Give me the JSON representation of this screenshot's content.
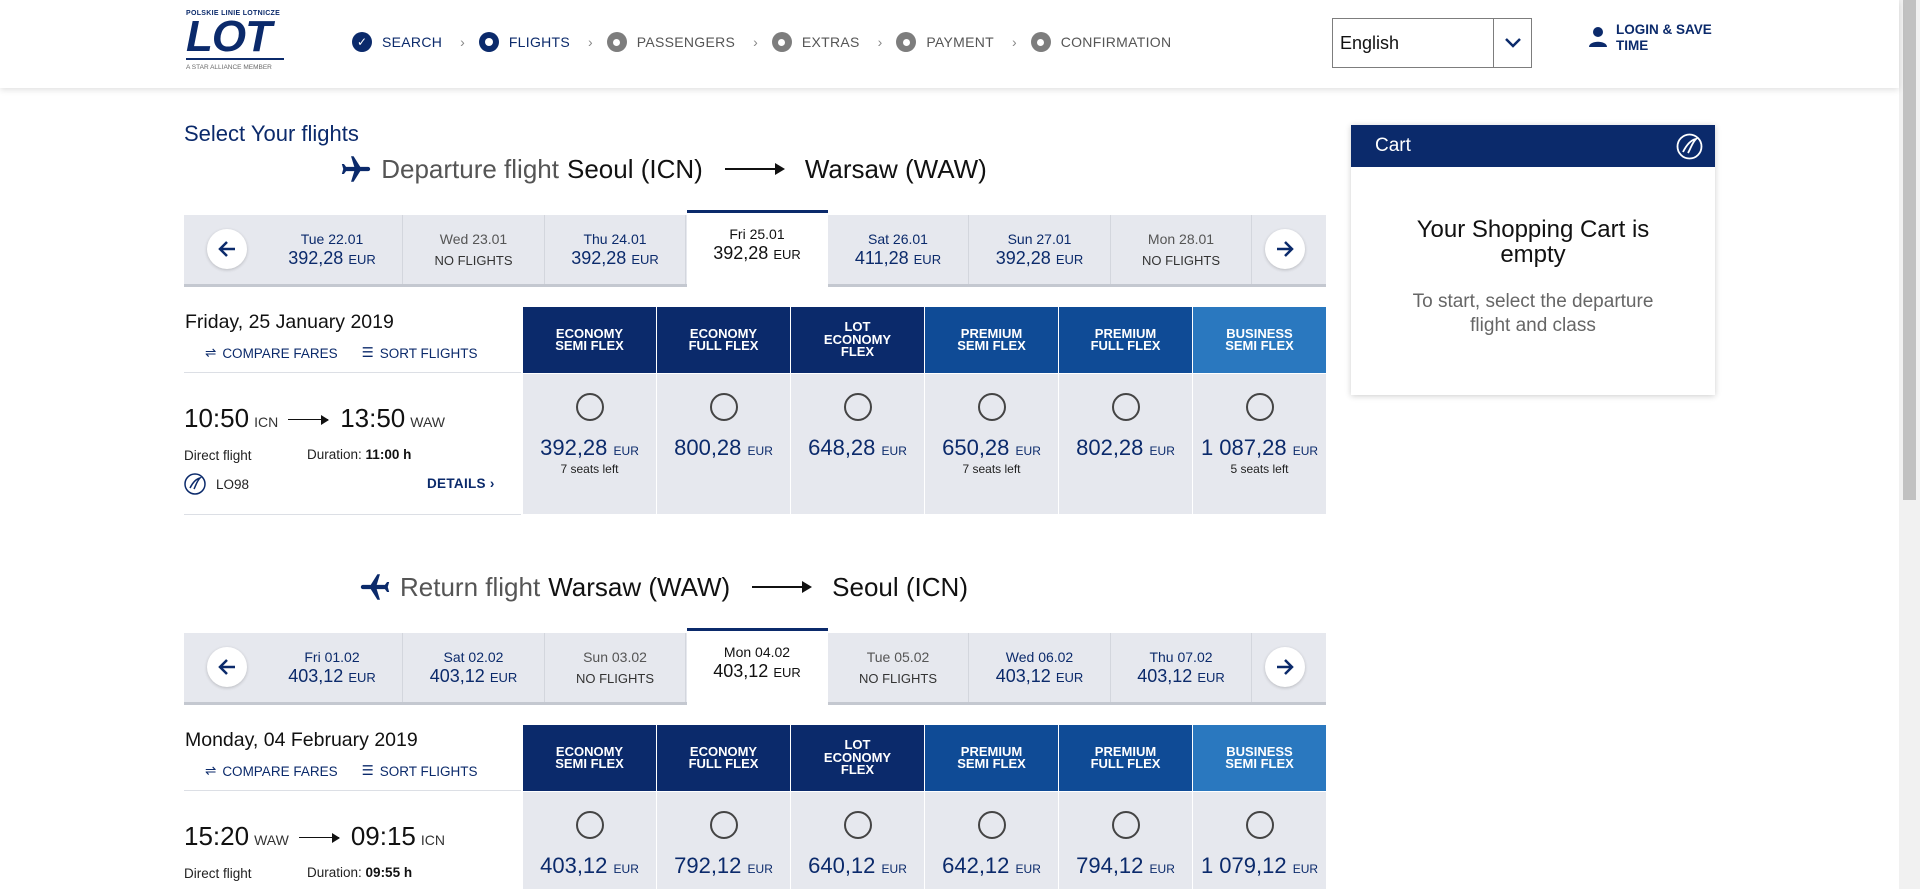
{
  "header": {
    "logo": {
      "top": "POLSKIE LINIE LOTNICZE",
      "main": "LOT",
      "alliance": "A STAR ALLIANCE MEMBER"
    },
    "steps": [
      {
        "label": "SEARCH",
        "state": "done"
      },
      {
        "label": "FLIGHTS",
        "state": "active"
      },
      {
        "label": "PASSENGERS",
        "state": "todo"
      },
      {
        "label": "EXTRAS",
        "state": "todo"
      },
      {
        "label": "PAYMENT",
        "state": "todo"
      },
      {
        "label": "CONFIRMATION",
        "state": "todo"
      }
    ],
    "language": "English",
    "login": {
      "line1": "LOGIN & SAVE",
      "line2": "TIME"
    }
  },
  "page_title": "Select Your flights",
  "departure": {
    "kind": "Departure flight",
    "from": "Seoul (ICN)",
    "to": "Warsaw (WAW)",
    "dates": [
      {
        "day": "Tue 22.01",
        "price": "392,28",
        "cur": "EUR"
      },
      {
        "day": "Wed 23.01",
        "nf": "NO FLIGHTS"
      },
      {
        "day": "Thu 24.01",
        "price": "392,28",
        "cur": "EUR"
      },
      {
        "day": "Fri 25.01",
        "price": "392,28",
        "cur": "EUR",
        "selected": true
      },
      {
        "day": "Sat 26.01",
        "price": "411,28",
        "cur": "EUR"
      },
      {
        "day": "Sun 27.01",
        "price": "392,28",
        "cur": "EUR"
      },
      {
        "day": "Mon 28.01",
        "nf": "NO FLIGHTS"
      }
    ],
    "day_label": "Friday, 25 January 2019",
    "compare": "COMPARE FARES",
    "sort": "SORT FLIGHTS",
    "flight": {
      "dep_time": "10:50",
      "dep_ap": "ICN",
      "arr_time": "13:50",
      "arr_ap": "WAW",
      "type": "Direct flight",
      "duration_label": "Duration:",
      "duration": "11:00 h",
      "number": "LO98",
      "details": "DETAILS"
    },
    "fares": [
      {
        "price": "392,28",
        "cur": "EUR",
        "seats": "7 seats left"
      },
      {
        "price": "800,28",
        "cur": "EUR",
        "seats": ""
      },
      {
        "price": "648,28",
        "cur": "EUR",
        "seats": ""
      },
      {
        "price": "650,28",
        "cur": "EUR",
        "seats": "7 seats left"
      },
      {
        "price": "802,28",
        "cur": "EUR",
        "seats": ""
      },
      {
        "price": "1 087,28",
        "cur": "EUR",
        "seats": "5 seats left"
      }
    ]
  },
  "return": {
    "kind": "Return flight",
    "from": "Warsaw (WAW)",
    "to": "Seoul (ICN)",
    "dates": [
      {
        "day": "Fri 01.02",
        "price": "403,12",
        "cur": "EUR"
      },
      {
        "day": "Sat 02.02",
        "price": "403,12",
        "cur": "EUR"
      },
      {
        "day": "Sun 03.02",
        "nf": "NO FLIGHTS"
      },
      {
        "day": "Mon 04.02",
        "price": "403,12",
        "cur": "EUR",
        "selected": true
      },
      {
        "day": "Tue 05.02",
        "nf": "NO FLIGHTS"
      },
      {
        "day": "Wed 06.02",
        "price": "403,12",
        "cur": "EUR"
      },
      {
        "day": "Thu 07.02",
        "price": "403,12",
        "cur": "EUR"
      }
    ],
    "day_label": "Monday, 04 February 2019",
    "compare": "COMPARE FARES",
    "sort": "SORT FLIGHTS",
    "flight": {
      "dep_time": "15:20",
      "dep_ap": "WAW",
      "arr_time": "09:15",
      "arr_ap": "ICN",
      "type": "Direct flight",
      "duration_label": "Duration:",
      "duration": "09:55 h"
    },
    "fares": [
      {
        "price": "403,12",
        "cur": "EUR"
      },
      {
        "price": "792,12",
        "cur": "EUR"
      },
      {
        "price": "640,12",
        "cur": "EUR"
      },
      {
        "price": "642,12",
        "cur": "EUR"
      },
      {
        "price": "794,12",
        "cur": "EUR"
      },
      {
        "price": "1 079,12",
        "cur": "EUR"
      }
    ]
  },
  "fare_classes": [
    {
      "l1": "ECONOMY",
      "l2": "SEMI FLEX",
      "l3": "",
      "color": "#0b2a6b"
    },
    {
      "l1": "ECONOMY",
      "l2": "FULL FLEX",
      "l3": "",
      "color": "#0b2a6b"
    },
    {
      "l1": "LOT",
      "l2": "ECONOMY",
      "l3": "FLEX",
      "color": "#0b2a6b"
    },
    {
      "l1": "PREMIUM",
      "l2": "SEMI FLEX",
      "l3": "",
      "color": "#0f4b96"
    },
    {
      "l1": "PREMIUM",
      "l2": "FULL FLEX",
      "l3": "",
      "color": "#0f4b96"
    },
    {
      "l1": "BUSINESS",
      "l2": "SEMI FLEX",
      "l3": "",
      "color": "#2a78bf"
    }
  ],
  "cart": {
    "title": "Cart",
    "empty_l1": "Your Shopping Cart is",
    "empty_l2": "empty",
    "hint_l1": "To start, select the departure",
    "hint_l2": "flight and class"
  }
}
